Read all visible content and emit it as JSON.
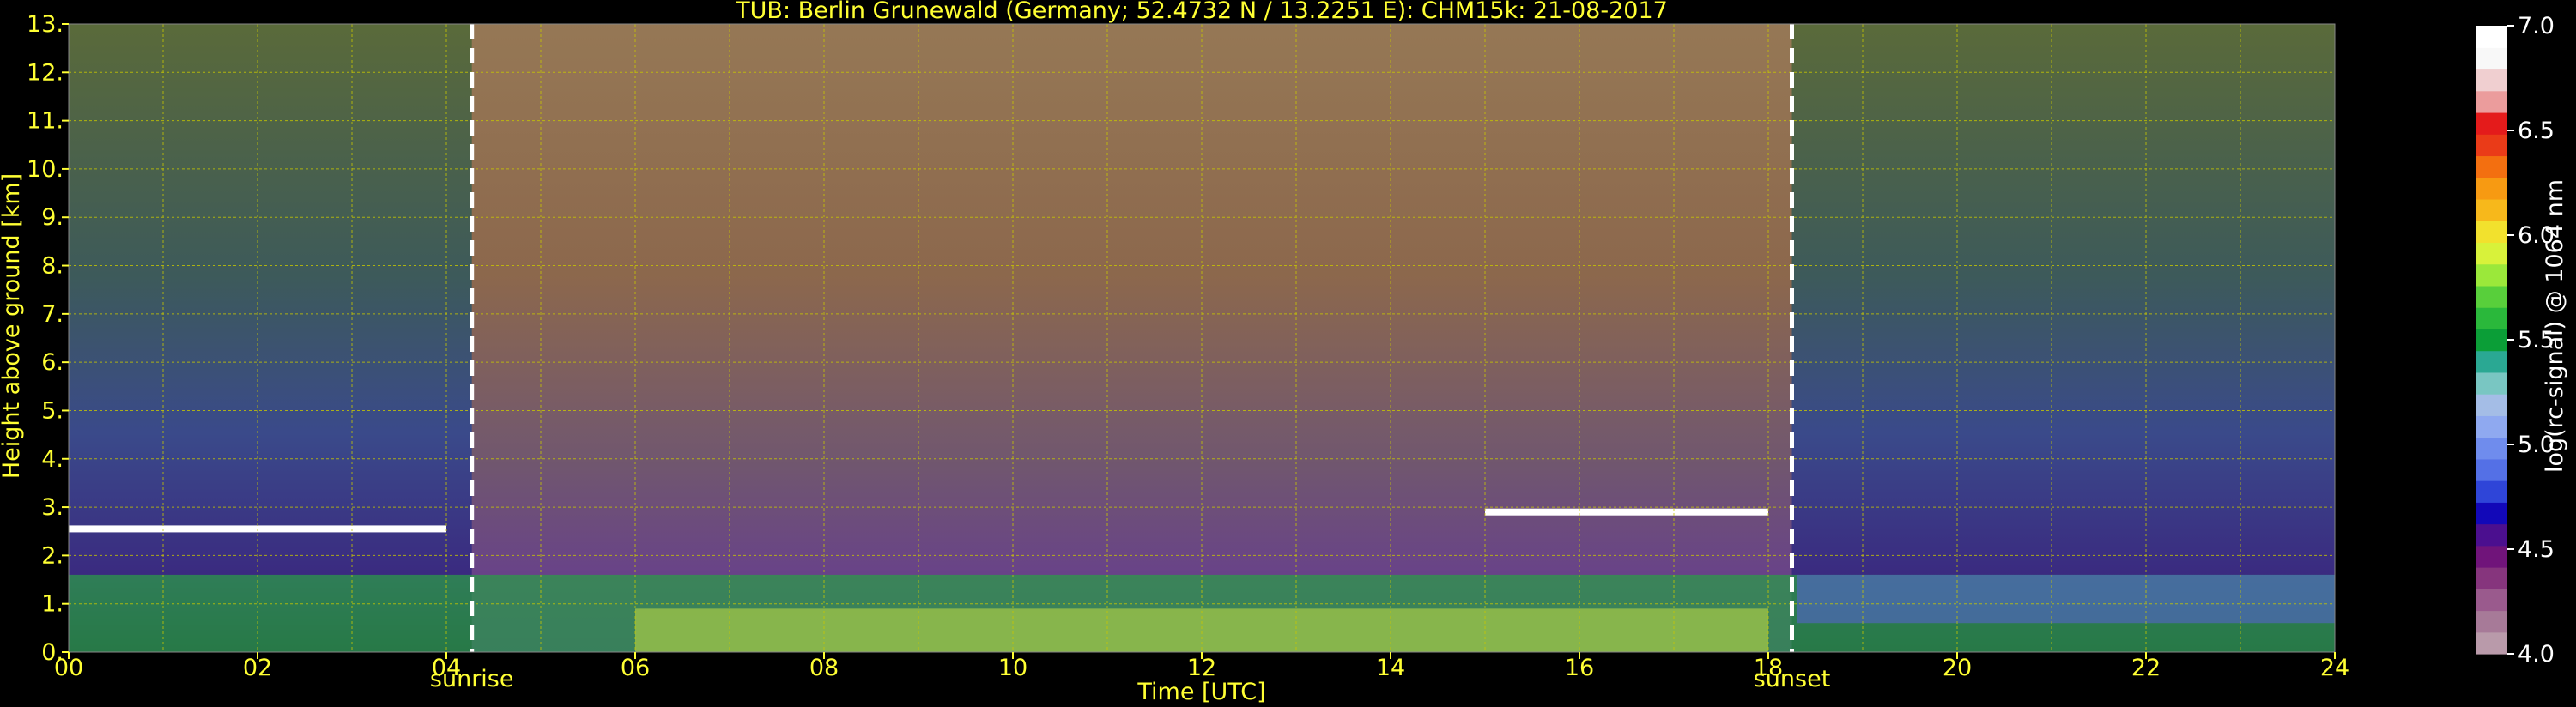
{
  "chart_data": {
    "type": "heatmap",
    "title": "TUB: Berlin Grunewald (Germany; 52.4732 N / 13.2251 E):    CHM15k: 21-08-2017",
    "xlabel": "Time [UTC]",
    "ylabel": "Height above ground [km]",
    "xlim": [
      0,
      24
    ],
    "ylim": [
      0,
      13
    ],
    "x_ticks": [
      "00",
      "02",
      "04",
      "06",
      "08",
      "10",
      "12",
      "14",
      "16",
      "18",
      "20",
      "22",
      "24"
    ],
    "y_ticks": [
      "0.",
      "1.",
      "2.",
      "3.",
      "4.",
      "5.",
      "6.",
      "7.",
      "8.",
      "9.",
      "10.",
      "11.",
      "12.",
      "13."
    ],
    "grid": true,
    "events": [
      {
        "label": "sunrise",
        "time_utc": 4.27
      },
      {
        "label": "sunset",
        "time_utc": 18.25
      }
    ],
    "colorbar": {
      "label": "log(rc-signal) @ 1064 nm",
      "range": [
        4.0,
        7.0
      ],
      "ticks": [
        "4.0",
        "4.5",
        "5.0",
        "5.5",
        "6.0",
        "6.5",
        "7.0"
      ],
      "colors": [
        "#b99aaa",
        "#a77a98",
        "#9a5a8d",
        "#86357d",
        "#70147a",
        "#4b0f8f",
        "#1208b8",
        "#2f45d8",
        "#5470e6",
        "#6f8ced",
        "#8fa9f0",
        "#a4bde6",
        "#79c6c2",
        "#2aa893",
        "#0b9e37",
        "#2ab83b",
        "#58cf3b",
        "#9be83a",
        "#d8f23a",
        "#f2e12d",
        "#f7b81b",
        "#f79a12",
        "#f36f10",
        "#ea3b18",
        "#e41b1b",
        "#eb9c9c",
        "#f0cfd0",
        "#f8f8f8",
        "#ffffff"
      ]
    },
    "layers": [
      {
        "name": "boundary layer (green/yellow)",
        "time_start": 0,
        "time_end": 24,
        "top_km": 1.6
      },
      {
        "name": "residual cloud layer",
        "time_start": 0,
        "time_end": 4,
        "height_km": 2.55
      },
      {
        "name": "cloud tops",
        "time_start": 15,
        "time_end": 18,
        "height_km": 2.9
      }
    ]
  },
  "colors": {
    "axes": "#ffff33",
    "grid": "#d4d400",
    "event_line": "#ffffff",
    "background": "#000000"
  }
}
